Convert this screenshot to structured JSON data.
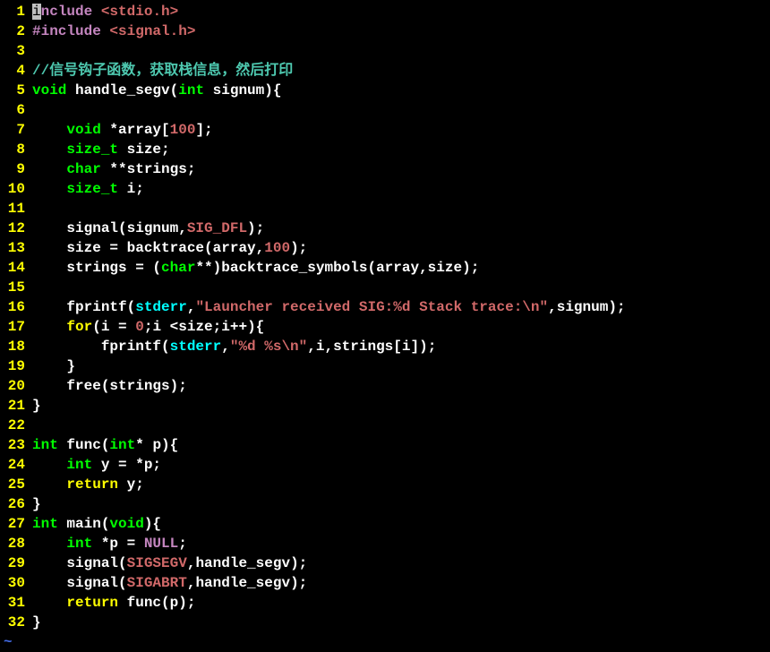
{
  "lines": [
    {
      "n": 1,
      "tokens": [
        {
          "c": "tok-hl",
          "t": "i"
        },
        {
          "c": "tok-preproc",
          "t": "nclude "
        },
        {
          "c": "tok-include-hdr",
          "t": "<stdio.h>"
        }
      ]
    },
    {
      "n": 2,
      "tokens": [
        {
          "c": "tok-preproc",
          "t": "#include "
        },
        {
          "c": "tok-include-hdr",
          "t": "<signal.h>"
        }
      ]
    },
    {
      "n": 3,
      "tokens": []
    },
    {
      "n": 4,
      "tokens": [
        {
          "c": "tok-comment",
          "t": "//信号钩子函数，获取栈信息，然后打印"
        }
      ]
    },
    {
      "n": 5,
      "tokens": [
        {
          "c": "tok-type",
          "t": "void"
        },
        {
          "c": "tok-default",
          "t": " handle_segv("
        },
        {
          "c": "tok-type",
          "t": "int"
        },
        {
          "c": "tok-default",
          "t": " signum){"
        }
      ]
    },
    {
      "n": 6,
      "tokens": []
    },
    {
      "n": 7,
      "tokens": [
        {
          "c": "tok-default",
          "t": "    "
        },
        {
          "c": "tok-type",
          "t": "void"
        },
        {
          "c": "tok-default",
          "t": " *array["
        },
        {
          "c": "tok-number",
          "t": "100"
        },
        {
          "c": "tok-default",
          "t": "];"
        }
      ]
    },
    {
      "n": 8,
      "tokens": [
        {
          "c": "tok-default",
          "t": "    "
        },
        {
          "c": "tok-type",
          "t": "size_t"
        },
        {
          "c": "tok-default",
          "t": " size;"
        }
      ]
    },
    {
      "n": 9,
      "tokens": [
        {
          "c": "tok-default",
          "t": "    "
        },
        {
          "c": "tok-type",
          "t": "char"
        },
        {
          "c": "tok-default",
          "t": " **strings;"
        }
      ]
    },
    {
      "n": 10,
      "tokens": [
        {
          "c": "tok-default",
          "t": "    "
        },
        {
          "c": "tok-type",
          "t": "size_t"
        },
        {
          "c": "tok-default",
          "t": " i;"
        }
      ]
    },
    {
      "n": 11,
      "tokens": []
    },
    {
      "n": 12,
      "tokens": [
        {
          "c": "tok-default",
          "t": "    signal(signum,"
        },
        {
          "c": "tok-const",
          "t": "SIG_DFL"
        },
        {
          "c": "tok-default",
          "t": ");"
        }
      ]
    },
    {
      "n": 13,
      "tokens": [
        {
          "c": "tok-default",
          "t": "    size = backtrace(array,"
        },
        {
          "c": "tok-number",
          "t": "100"
        },
        {
          "c": "tok-default",
          "t": ");"
        }
      ]
    },
    {
      "n": 14,
      "tokens": [
        {
          "c": "tok-default",
          "t": "    strings = ("
        },
        {
          "c": "tok-type",
          "t": "char"
        },
        {
          "c": "tok-default",
          "t": "**)backtrace_symbols(array,size);"
        }
      ]
    },
    {
      "n": 15,
      "tokens": []
    },
    {
      "n": 16,
      "tokens": [
        {
          "c": "tok-default",
          "t": "    fprintf("
        },
        {
          "c": "tok-stderr",
          "t": "stderr"
        },
        {
          "c": "tok-default",
          "t": ","
        },
        {
          "c": "tok-string",
          "t": "\"Launcher received SIG:%d Stack trace:\\n\""
        },
        {
          "c": "tok-default",
          "t": ",signum);"
        }
      ]
    },
    {
      "n": 17,
      "tokens": [
        {
          "c": "tok-default",
          "t": "    "
        },
        {
          "c": "tok-keyword",
          "t": "for"
        },
        {
          "c": "tok-default",
          "t": "(i = "
        },
        {
          "c": "tok-number",
          "t": "0"
        },
        {
          "c": "tok-default",
          "t": ";i <size;i++){"
        }
      ]
    },
    {
      "n": 18,
      "tokens": [
        {
          "c": "tok-default",
          "t": "        fprintf("
        },
        {
          "c": "tok-stderr",
          "t": "stderr"
        },
        {
          "c": "tok-default",
          "t": ","
        },
        {
          "c": "tok-string",
          "t": "\"%d %s\\n\""
        },
        {
          "c": "tok-default",
          "t": ",i,strings[i]);"
        }
      ]
    },
    {
      "n": 19,
      "tokens": [
        {
          "c": "tok-default",
          "t": "    }"
        }
      ]
    },
    {
      "n": 20,
      "tokens": [
        {
          "c": "tok-default",
          "t": "    free(strings);"
        }
      ]
    },
    {
      "n": 21,
      "tokens": [
        {
          "c": "tok-default",
          "t": "}"
        }
      ]
    },
    {
      "n": 22,
      "tokens": []
    },
    {
      "n": 23,
      "tokens": [
        {
          "c": "tok-type",
          "t": "int"
        },
        {
          "c": "tok-default",
          "t": " func("
        },
        {
          "c": "tok-type",
          "t": "int"
        },
        {
          "c": "tok-default",
          "t": "* p){"
        }
      ]
    },
    {
      "n": 24,
      "tokens": [
        {
          "c": "tok-default",
          "t": "    "
        },
        {
          "c": "tok-type",
          "t": "int"
        },
        {
          "c": "tok-default",
          "t": " y = *p;"
        }
      ]
    },
    {
      "n": 25,
      "tokens": [
        {
          "c": "tok-default",
          "t": "    "
        },
        {
          "c": "tok-keyword",
          "t": "return"
        },
        {
          "c": "tok-default",
          "t": " y;"
        }
      ]
    },
    {
      "n": 26,
      "tokens": [
        {
          "c": "tok-default",
          "t": "}"
        }
      ]
    },
    {
      "n": 27,
      "tokens": [
        {
          "c": "tok-type",
          "t": "int"
        },
        {
          "c": "tok-default",
          "t": " main("
        },
        {
          "c": "tok-type",
          "t": "void"
        },
        {
          "c": "tok-default",
          "t": "){"
        }
      ]
    },
    {
      "n": 28,
      "tokens": [
        {
          "c": "tok-default",
          "t": "    "
        },
        {
          "c": "tok-type",
          "t": "int"
        },
        {
          "c": "tok-default",
          "t": " *p = "
        },
        {
          "c": "tok-null",
          "t": "NULL"
        },
        {
          "c": "tok-default",
          "t": ";"
        }
      ]
    },
    {
      "n": 29,
      "tokens": [
        {
          "c": "tok-default",
          "t": "    signal("
        },
        {
          "c": "tok-const",
          "t": "SIGSEGV"
        },
        {
          "c": "tok-default",
          "t": ",handle_segv);"
        }
      ]
    },
    {
      "n": 30,
      "tokens": [
        {
          "c": "tok-default",
          "t": "    signal("
        },
        {
          "c": "tok-const",
          "t": "SIGABRT"
        },
        {
          "c": "tok-default",
          "t": ",handle_segv);"
        }
      ]
    },
    {
      "n": 31,
      "tokens": [
        {
          "c": "tok-default",
          "t": "    "
        },
        {
          "c": "tok-keyword",
          "t": "return"
        },
        {
          "c": "tok-default",
          "t": " func(p);"
        }
      ]
    },
    {
      "n": 32,
      "tokens": [
        {
          "c": "tok-default",
          "t": "}"
        }
      ]
    }
  ],
  "tilde": "~"
}
